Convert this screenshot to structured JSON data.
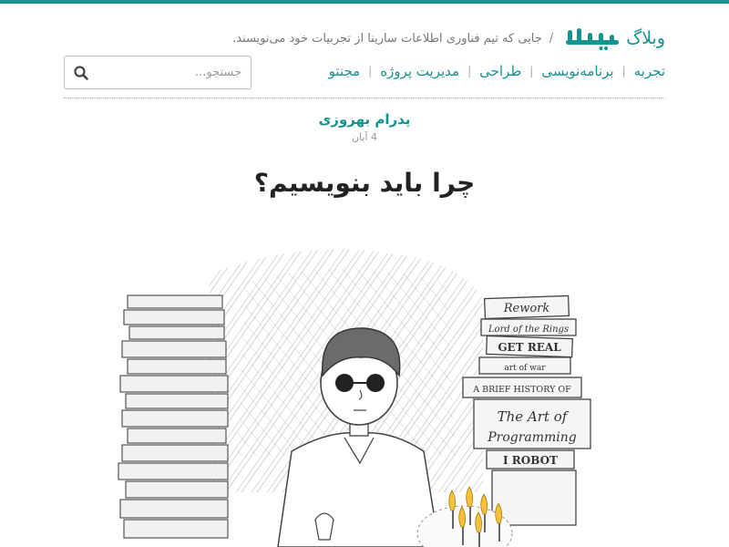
{
  "colors": {
    "accent": "#15938f",
    "text": "#222222",
    "muted": "#999999"
  },
  "header": {
    "blog_label": "وبلاگ",
    "logo_text": "سارینا",
    "separator": "/",
    "tagline": "جایی که تیم فناوری اطلاعات سارینا از تجربیات خود می‌نویسند."
  },
  "nav": {
    "items": [
      {
        "label": "تجربه"
      },
      {
        "label": "برنامه‌نویسی"
      },
      {
        "label": "طراحی"
      },
      {
        "label": "مدیریت پروژه"
      },
      {
        "label": "مجنتو"
      }
    ]
  },
  "search": {
    "placeholder": "جستجو...",
    "value": "",
    "icon": "search-icon"
  },
  "post": {
    "author": "پدرام بهروزی",
    "date": "4 آبان",
    "title": "چرا باید بنویسیم؟"
  },
  "illustration": {
    "books": [
      "Rework",
      "Lord of the Rings",
      "GET REAL",
      "art of war",
      "A BRIEF HISTORY OF",
      "The Art of",
      "Programming",
      "I ROBOT"
    ]
  }
}
